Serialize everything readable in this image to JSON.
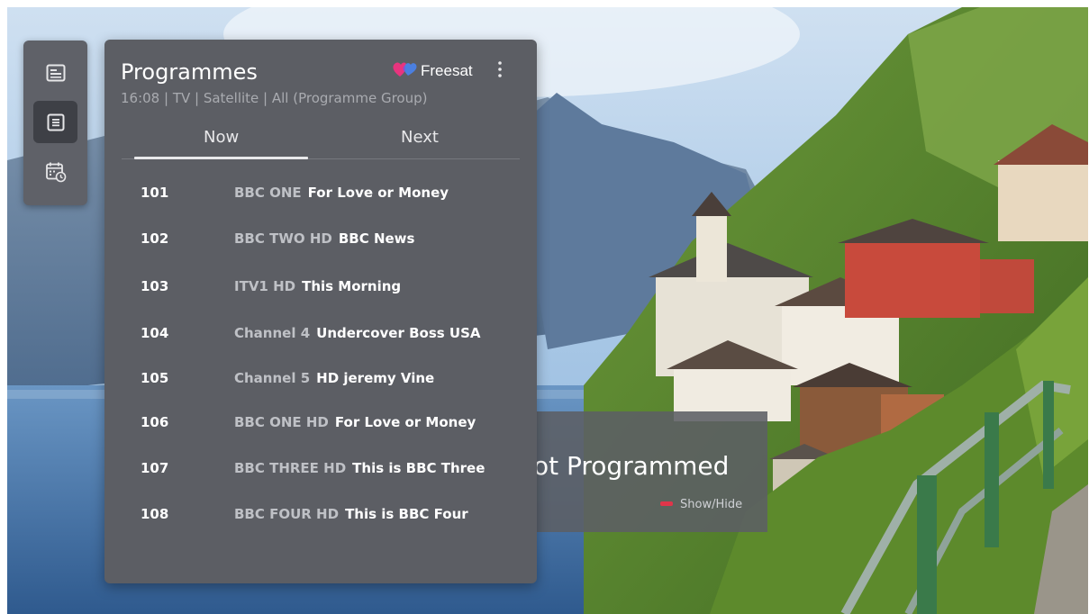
{
  "rail": {
    "items": [
      {
        "icon": "tv-guide-icon"
      },
      {
        "icon": "channel-list-icon",
        "active": true
      },
      {
        "icon": "schedule-calendar-icon"
      }
    ]
  },
  "panel": {
    "title": "Programmes",
    "subtitle": "16:08 | TV | Satellite | All (Programme Group)",
    "brand": "Freesat",
    "brand_icon": "freesat-heart-icon",
    "menu_icon": "more-vertical-icon",
    "tabs": [
      {
        "label": "Now",
        "selected": true
      },
      {
        "label": "Next",
        "selected": false
      }
    ],
    "channels": [
      {
        "number": "101",
        "name": "BBC ONE",
        "programme": "For Love or Money"
      },
      {
        "number": "102",
        "name": "BBC TWO HD",
        "programme": "BBC News"
      },
      {
        "number": "103",
        "name": "ITV1 HD",
        "programme": "This Morning"
      },
      {
        "number": "104",
        "name": "Channel 4",
        "programme": "Undercover Boss USA"
      },
      {
        "number": "105",
        "name": "Channel 5",
        "programme": "HD jeremy Vine"
      },
      {
        "number": "106",
        "name": "BBC ONE HD",
        "programme": "For Love or Money"
      },
      {
        "number": "107",
        "name": "BBC THREE HD",
        "programme": "This is BBC Three"
      },
      {
        "number": "108",
        "name": "BBC FOUR HD",
        "programme": "This is BBC Four"
      }
    ]
  },
  "notice": {
    "text": "ot Programmed",
    "hint": "Show/Hide",
    "hint_key_color": "#e0354a"
  },
  "colors": {
    "panel_bg": "#5c5e64",
    "rail_bg": "#5f6168",
    "active_bg": "#3e4046",
    "channel_name": "#bfc1c6",
    "subtitle": "#a9abb0"
  }
}
